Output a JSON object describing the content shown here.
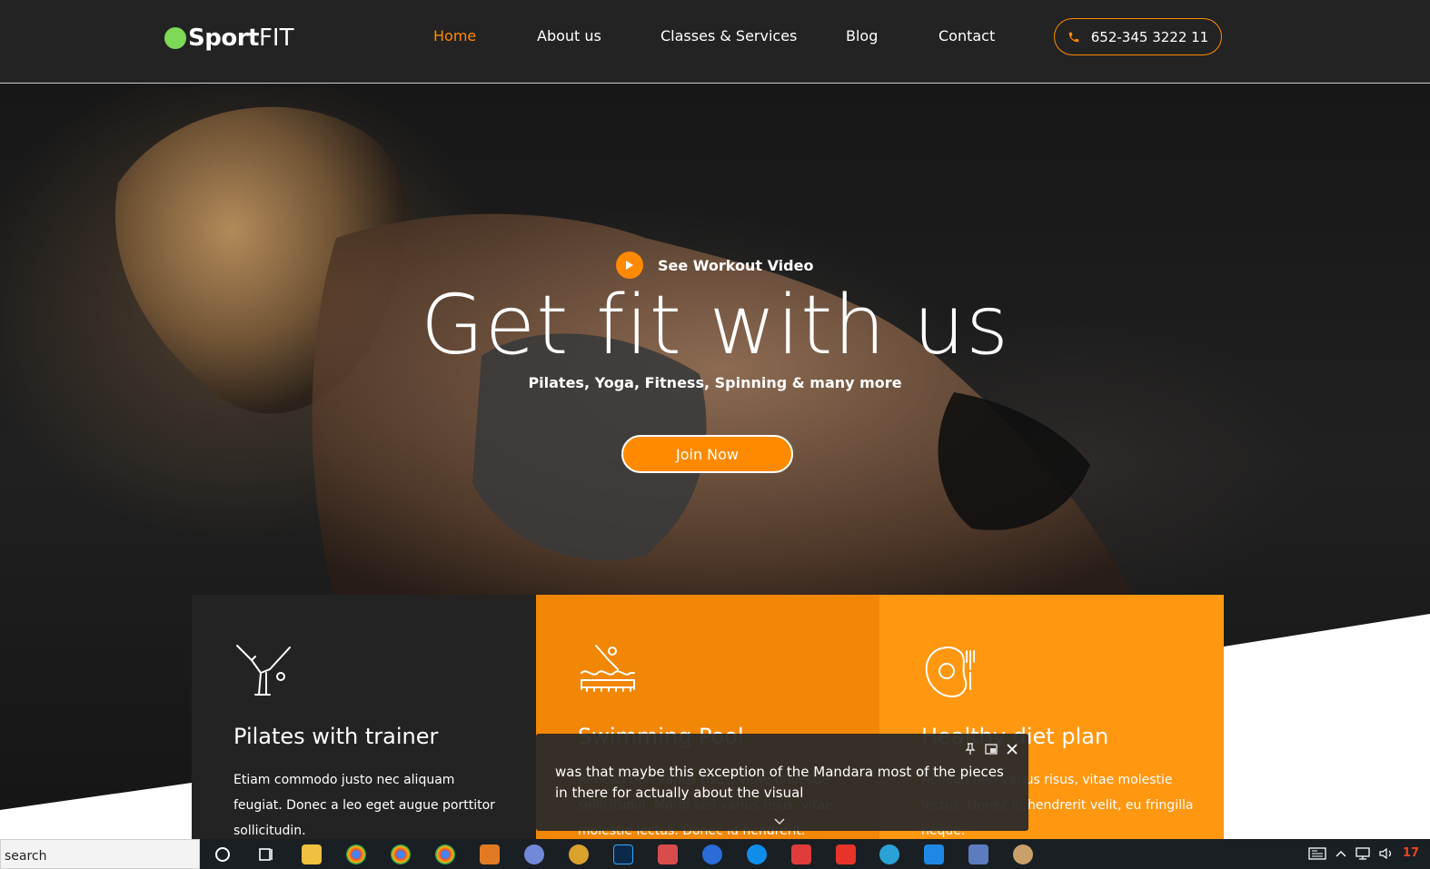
{
  "brand": {
    "logo_bold": "Sport",
    "logo_light": "FIT"
  },
  "nav": {
    "items": [
      {
        "label": "Home",
        "active": true
      },
      {
        "label": "About us",
        "active": false
      },
      {
        "label": "Classes & Services",
        "active": false
      },
      {
        "label": "Blog",
        "active": false
      },
      {
        "label": "Contact",
        "active": false
      }
    ],
    "phone": "652-345 3222 11"
  },
  "hero": {
    "video_link": "See Workout Video",
    "title": "Get fit with us",
    "subtitle": "Pilates, Yoga, Fitness, Spinning & many more",
    "cta": "Join Now"
  },
  "cards": [
    {
      "icon": "pilates-icon",
      "title": "Pilates with trainer",
      "text": "Etiam commodo justo nec aliquam feugiat. Donec a leo eget augue porttitor sollicitudin."
    },
    {
      "icon": "swimming-pool-icon",
      "title": "Swimming Pool",
      "text": "Aenean non varius risus, vitae molestie sollicitudin. Morbi sed varius risus, vitae molestie lectus. Donec id hendrerit."
    },
    {
      "icon": "diet-plan-icon",
      "title": "Healthy diet plan",
      "text": "Aenean non varius risus, vitae molestie lectus. Donec id hendrerit velit, eu fringilla neque."
    }
  ],
  "caption": {
    "text": "was that maybe this exception of the Mandara most of the pieces in there for actually about the visual"
  },
  "taskbar": {
    "search_text": "search",
    "clock": "17"
  },
  "colors": {
    "accent": "#ff8a00",
    "header_bg": "#232323",
    "card_dark": "#232323",
    "card_orange_1": "#f28705",
    "card_orange_2": "#ff9711",
    "logo_dot": "#7ed957"
  }
}
